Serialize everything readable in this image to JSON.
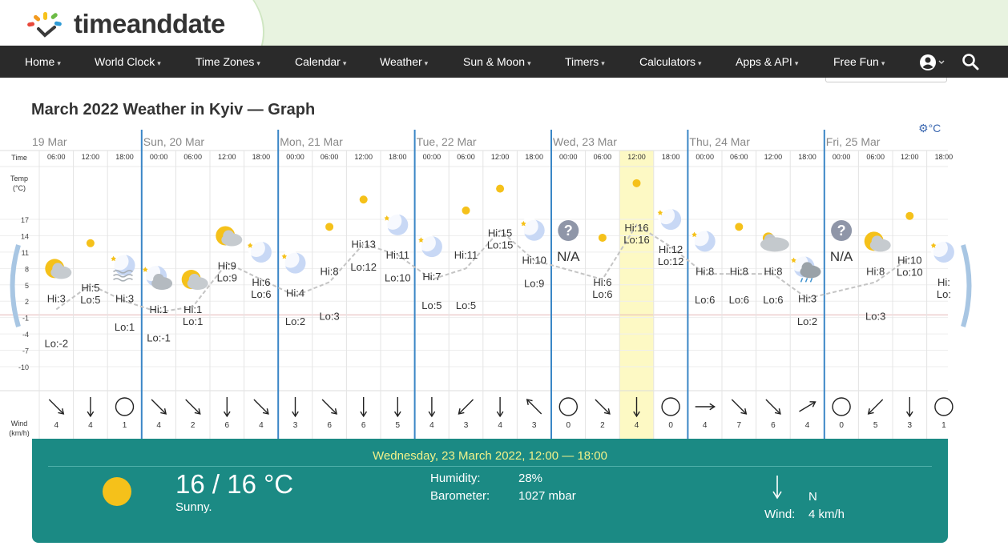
{
  "brand": {
    "name": "timeanddate"
  },
  "nav": {
    "items": [
      "Home",
      "World Clock",
      "Time Zones",
      "Calendar",
      "Weather",
      "Sun & Moon",
      "Timers",
      "Calculators",
      "Apps & API",
      "Free Fun"
    ],
    "account_icon": "user-circle-icon",
    "search_icon": "search-icon"
  },
  "page": {
    "title": "March 2022 Weather in Kyiv — Graph",
    "unit_toggle": "°C"
  },
  "graph": {
    "row_labels": {
      "time": "Time",
      "temp_line1": "Temp",
      "temp_line2": "(°C)",
      "wind_line1": "Wind",
      "wind_line2": "(km/h)"
    },
    "y_axis_ticks": [
      17,
      14,
      11,
      8,
      5,
      2,
      -1,
      -4,
      -7,
      -10
    ],
    "days": [
      {
        "label": "19 Mar",
        "partial": true
      },
      {
        "label": "Sun, 20 Mar"
      },
      {
        "label": "Mon, 21 Mar"
      },
      {
        "label": "Tue, 22 Mar"
      },
      {
        "label": "Wed, 23 Mar"
      },
      {
        "label": "Thu, 24 Mar"
      },
      {
        "label": "Fri, 25 Mar"
      }
    ],
    "slots": [
      {
        "time": "06:00",
        "icon": "partly-sunny-icon",
        "hi": "Hi:3",
        "lo": "Lo:-2",
        "wind": "4",
        "wind_dir": "nw-to-se-arrow"
      },
      {
        "time": "12:00",
        "icon": "sun-icon",
        "hi": "Hi:5",
        "lo": "Lo:5",
        "wind": "4",
        "wind_dir": "down-arrow"
      },
      {
        "time": "18:00",
        "icon": "fog-moon-icon",
        "hi": "Hi:3",
        "lo": "Lo:1",
        "wind": "1",
        "wind_dir": "calm-circle"
      },
      {
        "time": "00:00",
        "icon": "cloudy-moon-icon",
        "hi": "Hi:1",
        "lo": "Lo:-1",
        "wind": "4",
        "wind_dir": "nw-to-se-arrow"
      },
      {
        "time": "06:00",
        "icon": "partly-sunny-icon",
        "hi": "Hi:1",
        "lo": "Lo:1",
        "wind": "2",
        "wind_dir": "nw-to-se-arrow"
      },
      {
        "time": "12:00",
        "icon": "partly-sunny-icon",
        "hi": "Hi:9",
        "lo": "Lo:9",
        "wind": "6",
        "wind_dir": "down-arrow"
      },
      {
        "time": "18:00",
        "icon": "moon-icon",
        "hi": "Hi:6",
        "lo": "Lo:6",
        "wind": "4",
        "wind_dir": "nw-to-se-arrow"
      },
      {
        "time": "00:00",
        "icon": "moon-icon",
        "hi": "Hi:4",
        "lo": "Lo:2",
        "wind": "3",
        "wind_dir": "down-arrow"
      },
      {
        "time": "06:00",
        "icon": "sun-icon",
        "hi": "Hi:8",
        "lo": "Lo:3",
        "wind": "6",
        "wind_dir": "nw-to-se-arrow"
      },
      {
        "time": "12:00",
        "icon": "sun-icon",
        "hi": "Hi:13",
        "lo": "Lo:12",
        "wind": "6",
        "wind_dir": "down-arrow"
      },
      {
        "time": "18:00",
        "icon": "moon-icon",
        "hi": "Hi:11",
        "lo": "Lo:10",
        "wind": "5",
        "wind_dir": "down-arrow"
      },
      {
        "time": "00:00",
        "icon": "moon-icon",
        "hi": "Hi:7",
        "lo": "Lo:5",
        "wind": "4",
        "wind_dir": "down-arrow"
      },
      {
        "time": "06:00",
        "icon": "sun-icon",
        "hi": "Hi:11",
        "lo": "Lo:5",
        "wind": "3",
        "wind_dir": "ne-to-sw-arrow"
      },
      {
        "time": "12:00",
        "icon": "sun-icon",
        "hi": "Hi:15",
        "lo": "Lo:15",
        "wind": "4",
        "wind_dir": "down-arrow"
      },
      {
        "time": "18:00",
        "icon": "moon-icon",
        "hi": "Hi:10",
        "lo": "Lo:9",
        "wind": "3",
        "wind_dir": "se-to-nw-arrow"
      },
      {
        "time": "00:00",
        "icon": "unknown-icon",
        "hi": "N/A",
        "lo": "",
        "wind": "0",
        "wind_dir": "calm-circle"
      },
      {
        "time": "06:00",
        "icon": "sun-icon",
        "hi": "Hi:6",
        "lo": "Lo:6",
        "wind": "2",
        "wind_dir": "nw-to-se-arrow"
      },
      {
        "time": "12:00",
        "icon": "sun-icon",
        "hi": "Hi:16",
        "lo": "Lo:16",
        "wind": "4",
        "wind_dir": "down-arrow",
        "selected": true
      },
      {
        "time": "18:00",
        "icon": "moon-icon",
        "hi": "Hi:12",
        "lo": "Lo:12",
        "wind": "0",
        "wind_dir": "calm-circle"
      },
      {
        "time": "00:00",
        "icon": "moon-icon",
        "hi": "Hi:8",
        "lo": "Lo:6",
        "wind": "4",
        "wind_dir": "right-arrow"
      },
      {
        "time": "06:00",
        "icon": "sun-icon",
        "hi": "Hi:8",
        "lo": "Lo:6",
        "wind": "7",
        "wind_dir": "nw-to-se-arrow"
      },
      {
        "time": "12:00",
        "icon": "cloudy-icon",
        "hi": "Hi:8",
        "lo": "Lo:6",
        "wind": "6",
        "wind_dir": "nw-to-se-arrow"
      },
      {
        "time": "18:00",
        "icon": "rain-moon-icon",
        "hi": "Hi:3",
        "lo": "Lo:2",
        "wind": "4",
        "wind_dir": "sw-to-ne-arrow"
      },
      {
        "time": "00:00",
        "icon": "unknown-icon",
        "hi": "N/A",
        "lo": "",
        "wind": "0",
        "wind_dir": "calm-circle"
      },
      {
        "time": "06:00",
        "icon": "partly-sunny-icon",
        "hi": "Hi:8",
        "lo": "Lo:3",
        "wind": "5",
        "wind_dir": "ne-to-sw-arrow"
      },
      {
        "time": "12:00",
        "icon": "sun-icon",
        "hi": "Hi:10",
        "lo": "Lo:10",
        "wind": "3",
        "wind_dir": "down-arrow"
      },
      {
        "time": "18:00",
        "icon": "moon-icon",
        "hi": "Hi:",
        "lo": "Lo:",
        "wind": "1",
        "wind_dir": "calm-circle",
        "partial": true
      }
    ]
  },
  "detail": {
    "title": "Wednesday, 23 March 2022, 12:00 — 18:00",
    "icon": "sun-icon",
    "temp": "16 / 16 °C",
    "condition": "Sunny.",
    "humidity_label": "Humidity:",
    "humidity": "28%",
    "barometer_label": "Barometer:",
    "barometer": "1027 mbar",
    "wind_label": "Wind:",
    "wind": "4 km/h",
    "wind_dir": "N",
    "wind_icon": "down-arrow-icon"
  },
  "colors": {
    "nav_bg": "#2a2a2a",
    "panel_bg": "#1b8a84",
    "selected_col": "#fdf9c4",
    "day_divider": "#3a86c6",
    "sun": "#f5c11a",
    "moon": "#c8d8f5"
  }
}
